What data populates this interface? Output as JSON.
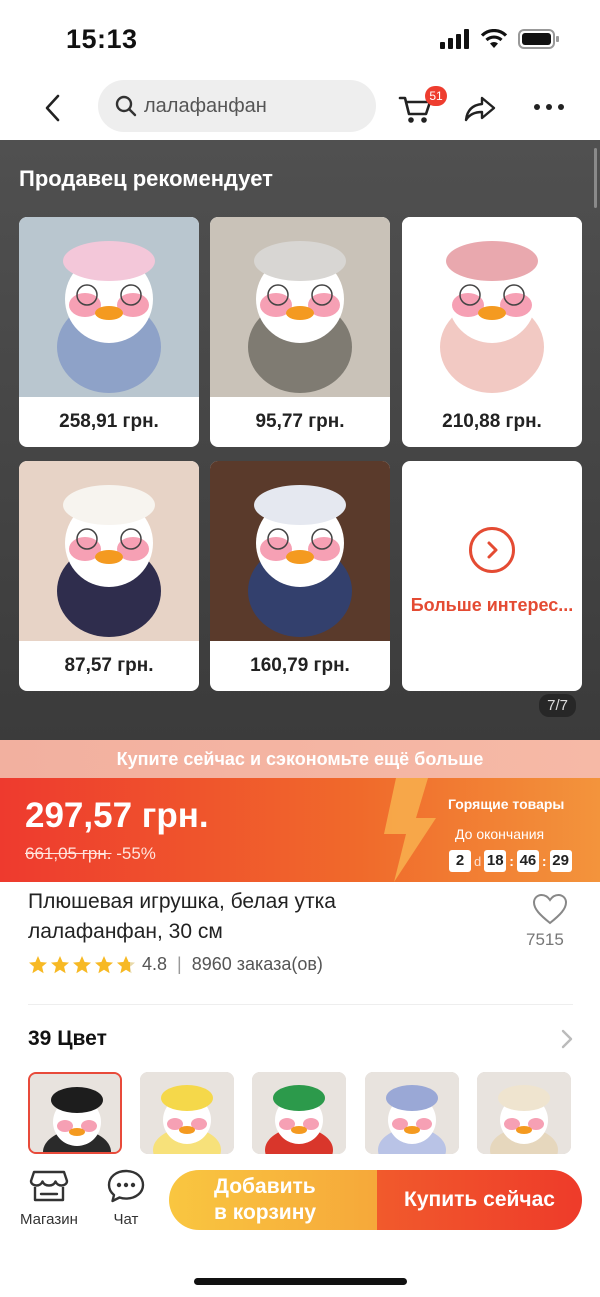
{
  "status_bar": {
    "time": "15:13"
  },
  "header": {
    "search_text": "лалафанфан",
    "cart_count": "51"
  },
  "recommendations": {
    "title": "Продавец рекомендует",
    "items": [
      {
        "price": "258,91 грн.",
        "bg": "#b9c6cf",
        "outfit": "#8ea2c8",
        "hat": "#f3c7d9"
      },
      {
        "price": "95,77 грн.",
        "bg": "#c9c2b8",
        "outfit": "#7f7b72",
        "hat": "#d8d6d3"
      },
      {
        "price": "210,88 грн.",
        "bg": "#ffffff",
        "outfit": "#f2c9c3",
        "hat": "#e9a8ae"
      },
      {
        "price": "87,57 грн.",
        "bg": "#e7d3c6",
        "outfit": "#2f2d4d",
        "hat": "#f7f4ef"
      },
      {
        "price": "160,79 грн.",
        "bg": "#5a3a2b",
        "outfit": "#33406d",
        "hat": "#e5e8f0"
      }
    ],
    "more_label": "Больше интерес...",
    "pager": "7/7"
  },
  "promo": {
    "text": "Купите сейчас и сэкономьте ещё больше"
  },
  "price": {
    "current": "297,57 грн.",
    "old": "661,05 грн.",
    "discount": "-55%",
    "hot_label": "Горящие товары",
    "ends_label": "До окончания",
    "countdown": {
      "days": "2",
      "day_unit": "d",
      "hours": "18",
      "minutes": "46",
      "seconds": "29"
    }
  },
  "product": {
    "title": "Плюшевая игрушка, белая утка лалафанфан, 30 см",
    "favorites": "7515",
    "rating": "4.8",
    "separator": "|",
    "orders": "8960 заказа(ов)"
  },
  "colors": {
    "title": "39 Цвет",
    "swatches": [
      {
        "name": "black",
        "hat": "#1d1d1d",
        "body": "#2a2a2a"
      },
      {
        "name": "yellow",
        "hat": "#f5d84a",
        "body": "#f7e17a"
      },
      {
        "name": "christmas",
        "hat": "#2c9a4b",
        "body": "#d9362b"
      },
      {
        "name": "blue",
        "hat": "#9aa8d6",
        "body": "#b9c3e6"
      },
      {
        "name": "cream",
        "hat": "#efe4cf",
        "body": "#e6d7bd"
      }
    ]
  },
  "bottom_bar": {
    "store_label": "Магазин",
    "chat_label": "Чат",
    "add_to_cart_line1": "Добавить",
    "add_to_cart_line2": "в корзину",
    "buy_now": "Купить сейчас"
  },
  "colors_theme": {
    "accent": "#ee3d2f",
    "orange": "#f06a2b",
    "yellow": "#f9c640"
  }
}
